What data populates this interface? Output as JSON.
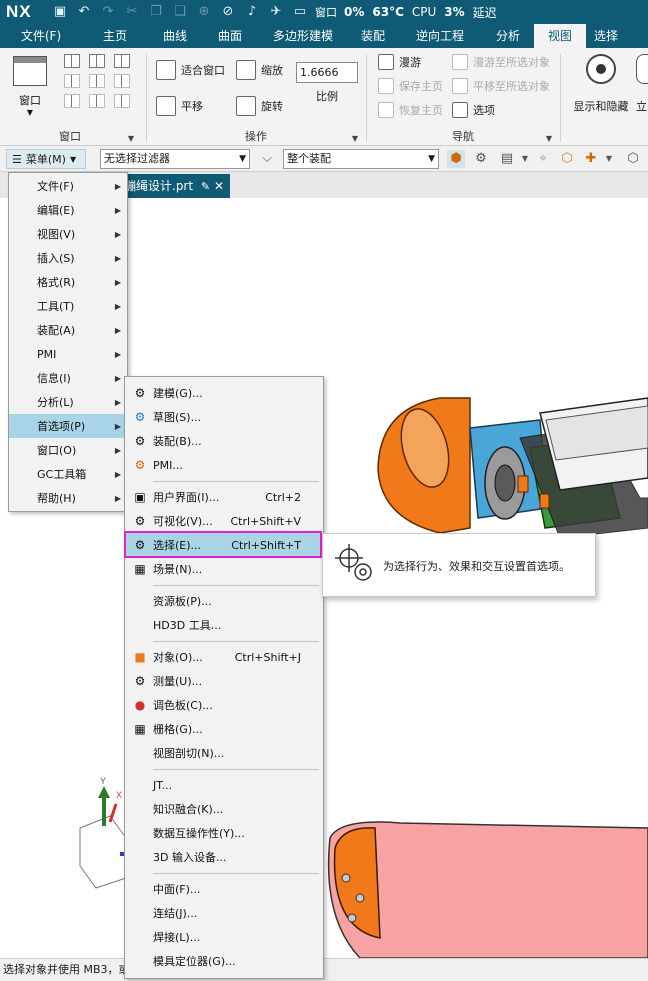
{
  "titlebar": {
    "logo": "NX",
    "window_label": "窗口",
    "stats": [
      {
        "label": "0%",
        "bold": true
      },
      {
        "label": "63°C",
        "bold": true
      },
      {
        "label": "CPU",
        "bold": false
      },
      {
        "label": "3%",
        "bold": true
      },
      {
        "label": "延迟",
        "bold": false
      }
    ]
  },
  "tabs": [
    {
      "label": "文件(F)",
      "w": 82
    },
    {
      "label": "主页",
      "w": 66
    },
    {
      "label": "曲线",
      "w": 54
    },
    {
      "label": "曲面",
      "w": 56
    },
    {
      "label": "多边形建模",
      "w": 90
    },
    {
      "label": "装配",
      "w": 50
    },
    {
      "label": "逆向工程",
      "w": 84
    },
    {
      "label": "分析",
      "w": 52
    },
    {
      "label": "视图",
      "w": 52,
      "active": true
    },
    {
      "label": "选择",
      "w": 40
    }
  ],
  "ribbon": {
    "window": {
      "label": "窗口",
      "group": "窗口"
    },
    "operation": {
      "fit": "适合窗口",
      "pan": "平移",
      "zoom": "缩放",
      "rotate": "旋转",
      "scale_value": "1.6666",
      "scale_label": "比例",
      "group": "操作"
    },
    "navigation": {
      "roam": "漫游",
      "roam_to": "漫游至所选对象",
      "save_home": "保存主页",
      "pan_to": "平移至所选对象",
      "restore_home": "恢复主页",
      "options": "选项",
      "group": "导航"
    },
    "show_hide": "显示和隐藏",
    "cut": "立"
  },
  "toolbar2": {
    "menu": "菜单(M)",
    "filter": "无选择过滤器",
    "assembly": "整个装配"
  },
  "doc_tab": {
    "name": "蹦绳设计.prt"
  },
  "statusbar": {
    "text": "选择对象并使用 MB3，或"
  },
  "main_menu": [
    {
      "label": "文件(F)",
      "sub": true
    },
    {
      "label": "编辑(E)",
      "sub": true
    },
    {
      "label": "视图(V)",
      "sub": true
    },
    {
      "label": "插入(S)",
      "sub": true
    },
    {
      "label": "格式(R)",
      "sub": true
    },
    {
      "label": "工具(T)",
      "sub": true
    },
    {
      "label": "装配(A)",
      "sub": true
    },
    {
      "label": "PMI",
      "sub": true
    },
    {
      "label": "信息(I)",
      "sub": true
    },
    {
      "label": "分析(L)",
      "sub": true
    },
    {
      "label": "首选项(P)",
      "sub": true,
      "hl": true
    },
    {
      "label": "窗口(O)",
      "sub": true
    },
    {
      "label": "GC工具箱",
      "sub": true
    },
    {
      "label": "帮助(H)",
      "sub": true
    }
  ],
  "sub_menu": [
    {
      "label": "建模(G)...",
      "icon": "gear-icon",
      "glyph": "⚙"
    },
    {
      "label": "草图(S)...",
      "icon": "sketch-icon",
      "glyph": "⚙"
    },
    {
      "label": "装配(B)...",
      "icon": "assembly-icon",
      "glyph": "⚙"
    },
    {
      "label": "PMI...",
      "icon": "pmi-icon",
      "glyph": "⚙"
    },
    {
      "sep": true
    },
    {
      "label": "用户界面(I)...",
      "shortcut": "Ctrl+2",
      "icon": "user-interface-icon",
      "glyph": "▣"
    },
    {
      "label": "可视化(V)...",
      "shortcut": "Ctrl+Shift+V",
      "icon": "visualization-icon",
      "glyph": "⚙"
    },
    {
      "label": "选择(E)...",
      "shortcut": "Ctrl+Shift+T",
      "icon": "selection-icon",
      "glyph": "⚙",
      "hl": true
    },
    {
      "label": "场景(N)...",
      "icon": "scene-icon",
      "glyph": "▦"
    },
    {
      "sep": true
    },
    {
      "label": "资源板(P)...",
      "icon": "",
      "glyph": ""
    },
    {
      "label": "HD3D 工具...",
      "icon": "",
      "glyph": ""
    },
    {
      "sep": true
    },
    {
      "label": "对象(O)...",
      "shortcut": "Ctrl+Shift+J",
      "icon": "object-icon",
      "glyph": "■"
    },
    {
      "label": "测量(U)...",
      "icon": "measure-icon",
      "glyph": "⚙"
    },
    {
      "label": "调色板(C)...",
      "icon": "palette-icon",
      "glyph": "●"
    },
    {
      "label": "栅格(G)...",
      "icon": "grid-icon",
      "glyph": "▦"
    },
    {
      "label": "视图剖切(N)...",
      "icon": "",
      "glyph": ""
    },
    {
      "sep": true
    },
    {
      "label": "JT...",
      "icon": "",
      "glyph": ""
    },
    {
      "label": "知识融合(K)...",
      "icon": "",
      "glyph": ""
    },
    {
      "label": "数据互操作性(Y)...",
      "icon": "",
      "glyph": ""
    },
    {
      "label": "3D 输入设备...",
      "icon": "",
      "glyph": ""
    },
    {
      "sep": true
    },
    {
      "label": "中面(F)...",
      "icon": "",
      "glyph": ""
    },
    {
      "label": "连结(J)...",
      "icon": "",
      "glyph": ""
    },
    {
      "label": "焊接(L)...",
      "icon": "",
      "glyph": ""
    },
    {
      "label": "模具定位器(G)...",
      "icon": "",
      "glyph": ""
    }
  ],
  "tooltip": {
    "text": "为选择行为、效果和交互设置首选项。"
  },
  "colors": {
    "title_bg": "#0f5a74",
    "highlight": "#a8d4e6",
    "select_frame": "#e020c8",
    "orange": "#f07a1a",
    "pink": "#f8a3a3"
  }
}
